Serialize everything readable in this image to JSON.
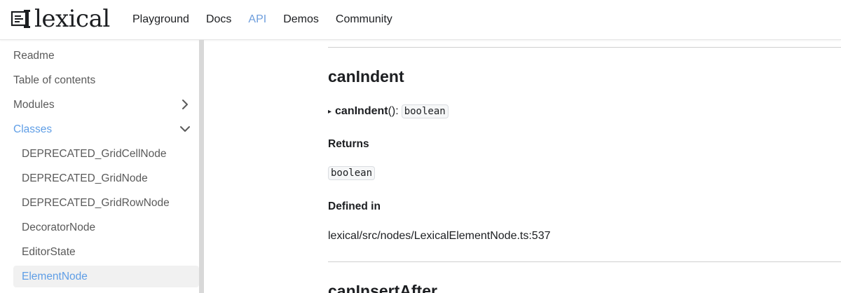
{
  "brand": {
    "name": "lexical",
    "logo_icon": "lexical-logo-icon"
  },
  "nav": {
    "links": [
      {
        "label": "Playground",
        "active": false
      },
      {
        "label": "Docs",
        "active": false
      },
      {
        "label": "API",
        "active": true
      },
      {
        "label": "Demos",
        "active": false
      },
      {
        "label": "Community",
        "active": false
      }
    ]
  },
  "sidebar": {
    "items": [
      {
        "label": "Readme"
      },
      {
        "label": "Table of contents"
      },
      {
        "label": "Modules",
        "chevron": "chevron-right-icon"
      },
      {
        "label": "Classes",
        "chevron": "chevron-down-icon",
        "active": true
      },
      {
        "label": "DEPRECATED_GridCellNode"
      },
      {
        "label": "DEPRECATED_GridNode"
      },
      {
        "label": "DEPRECATED_GridRowNode"
      },
      {
        "label": "DecoratorNode"
      },
      {
        "label": "EditorState"
      },
      {
        "label": "ElementNode",
        "active": true,
        "selected": true
      }
    ]
  },
  "main": {
    "method_title": "canIndent",
    "signature": {
      "name": "canIndent",
      "parens": "():",
      "return_type": "boolean"
    },
    "returns_heading": "Returns",
    "returns_type": "boolean",
    "defined_heading": "Defined in",
    "defined_location": "lexical/src/nodes/LexicalElementNode.ts:537",
    "next_method_title": "canInsertAfter"
  },
  "colors": {
    "accent": "#5f9ee6",
    "nav_active": "#6e9edc",
    "text": "#1c1e21"
  }
}
